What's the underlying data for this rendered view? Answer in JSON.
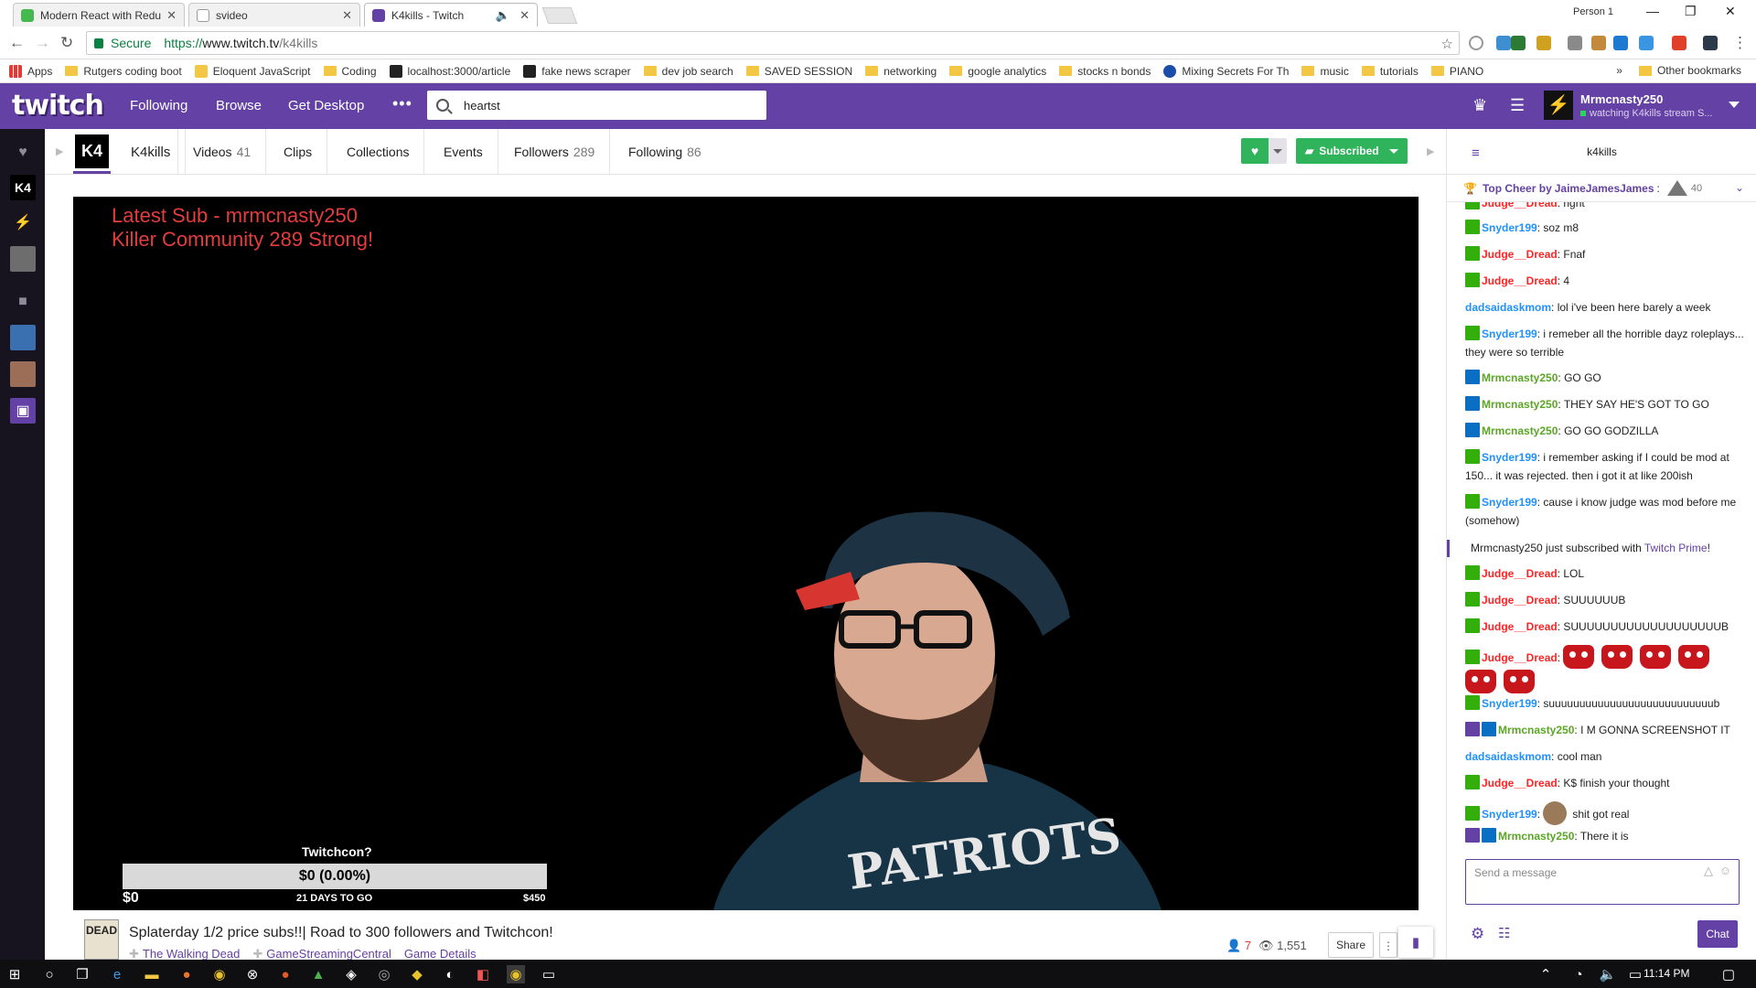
{
  "browser": {
    "tabs": [
      {
        "title": "Modern React with Redu",
        "color": "#45b84f"
      },
      {
        "title": "svideo",
        "color": "#dddddd"
      },
      {
        "title": "K4kills - Twitch",
        "color": "#6441a4"
      }
    ],
    "profile": "Person 1",
    "address": {
      "secure_label": "Secure",
      "scheme": "https://",
      "host": "www.twitch.tv",
      "path": "/k4kills"
    },
    "bookmarks": [
      {
        "label": "Apps",
        "icon": "apps-grid-icon"
      },
      {
        "label": "Rutgers coding boot",
        "icon": "folder-icon"
      },
      {
        "label": "Eloquent JavaScript",
        "icon": "ejs-icon"
      },
      {
        "label": "Coding",
        "icon": "folder-icon"
      },
      {
        "label": "localhost:3000/article",
        "icon": "react-icon"
      },
      {
        "label": "fake news scraper",
        "icon": "react-icon"
      },
      {
        "label": "dev job search",
        "icon": "folder-icon"
      },
      {
        "label": "SAVED SESSION",
        "icon": "folder-icon"
      },
      {
        "label": "networking",
        "icon": "folder-icon"
      },
      {
        "label": "google analytics",
        "icon": "folder-icon"
      },
      {
        "label": "stocks n bonds",
        "icon": "folder-icon"
      },
      {
        "label": "Mixing Secrets For Th",
        "icon": "globe-icon"
      },
      {
        "label": "music",
        "icon": "folder-icon"
      },
      {
        "label": "tutorials",
        "icon": "folder-icon"
      },
      {
        "label": "PIANO",
        "icon": "folder-icon"
      }
    ],
    "other_bookmarks": "Other bookmarks"
  },
  "twitch_nav": {
    "logo": "twitch",
    "links": [
      "Following",
      "Browse",
      "Get Desktop"
    ],
    "more": "•••",
    "search_value": "heartst",
    "user": {
      "name": "Mrmcnasty250",
      "status": "watching K4kills stream S..."
    }
  },
  "channel": {
    "avatar": "K4",
    "name": "K4kills",
    "tabs": [
      {
        "label": "Videos",
        "count": "41"
      },
      {
        "label": "Clips",
        "count": ""
      },
      {
        "label": "Collections",
        "count": ""
      },
      {
        "label": "Events",
        "count": ""
      },
      {
        "label": "Followers",
        "count": "289"
      },
      {
        "label": "Following",
        "count": "86"
      }
    ],
    "subscribe_label": "Subscribed",
    "accent": "#2fb35b"
  },
  "video": {
    "overlay_line1": "Latest Sub - mrmcnasty250",
    "overlay_line2": "Killer Community 289 Strong!",
    "goal": {
      "title": "Twitchcon?",
      "progress_text": "$0 (0.00%)",
      "progress": 0,
      "min": "$0",
      "days": "21 DAYS TO GO",
      "max": "$450"
    }
  },
  "stream": {
    "game_box": "DEAD",
    "title": "Splaterday 1/2 price subs!!| Road to 300 followers and Twitchcon!",
    "game": "The Walking Dead",
    "community": "GameStreamingCentral",
    "details": "Game Details",
    "viewers": "7",
    "views": "1,551",
    "share": "Share"
  },
  "chat": {
    "room": "k4kills",
    "top_cheer": {
      "label": "Top Cheer by",
      "user": "JaimeJamesJames",
      "amount": "40"
    },
    "messages": [
      {
        "badges": [
          "mod"
        ],
        "user": "Judge__Dread",
        "color": "red",
        "text": "right"
      },
      {
        "badges": [
          "mod"
        ],
        "user": "Snyder199",
        "color": "blue",
        "text": "soz m8"
      },
      {
        "badges": [
          "mod"
        ],
        "user": "Judge__Dread",
        "color": "red",
        "text": "Fnaf"
      },
      {
        "badges": [
          "mod"
        ],
        "user": "Judge__Dread",
        "color": "red",
        "text": "4"
      },
      {
        "badges": [],
        "user": "dadsaidaskmom",
        "color": "blue",
        "text": "lol i've been here barely a week"
      },
      {
        "badges": [
          "mod"
        ],
        "user": "Snyder199",
        "color": "blue",
        "text": "i remeber all the horrible dayz roleplays... they were so terrible"
      },
      {
        "badges": [
          "prime"
        ],
        "user": "Mrmcnasty250",
        "color": "green",
        "text": "GO GO"
      },
      {
        "badges": [
          "prime"
        ],
        "user": "Mrmcnasty250",
        "color": "green",
        "text": "THEY SAY HE'S GOT TO GO"
      },
      {
        "badges": [
          "prime"
        ],
        "user": "Mrmcnasty250",
        "color": "green",
        "text": "GO GO GODZILLA"
      },
      {
        "badges": [
          "mod"
        ],
        "user": "Snyder199",
        "color": "blue",
        "text": "i remember asking if I could be mod at 150... it was rejected. then i got it at like 200ish"
      },
      {
        "badges": [
          "mod"
        ],
        "user": "Snyder199",
        "color": "blue",
        "text": "cause i know judge was mod before me (somehow)"
      },
      {
        "system": true,
        "text": "Mrmcnasty250 just subscribed with",
        "link": "Twitch Prime",
        "end": "!"
      },
      {
        "badges": [
          "mod"
        ],
        "user": "Judge__Dread",
        "color": "red",
        "text": "LOL"
      },
      {
        "badges": [
          "mod"
        ],
        "user": "Judge__Dread",
        "color": "red",
        "text": "SUUUUUUB"
      },
      {
        "badges": [
          "mod"
        ],
        "user": "Judge__Dread",
        "color": "red",
        "text": "SUUUUUUUUUUUUUUUUUUUB"
      },
      {
        "badges": [
          "mod"
        ],
        "user": "Judge__Dread",
        "color": "red",
        "text": "",
        "emotes": 6
      },
      {
        "badges": [
          "mod"
        ],
        "user": "Snyder199",
        "color": "blue",
        "text": "suuuuuuuuuuuuuuuuuuuuuuuuuuub"
      },
      {
        "badges": [
          "sub",
          "prime"
        ],
        "user": "Mrmcnasty250",
        "color": "green",
        "text": "I M GONNA SCREENSHOT IT"
      },
      {
        "badges": [],
        "user": "dadsaidaskmom",
        "color": "blue",
        "text": "cool man"
      },
      {
        "badges": [
          "mod"
        ],
        "user": "Judge__Dread",
        "color": "red",
        "text": "K$ finish your thought"
      },
      {
        "badges": [
          "mod"
        ],
        "user": "Snyder199",
        "color": "blue",
        "text": "shit got real",
        "avatar_emote": true
      },
      {
        "badges": [
          "sub",
          "prime"
        ],
        "user": "Mrmcnasty250",
        "color": "green",
        "text": "There it is"
      }
    ],
    "input_placeholder": "Send a message",
    "send_label": "Chat"
  },
  "taskbar": {
    "time": "11:14 PM"
  }
}
